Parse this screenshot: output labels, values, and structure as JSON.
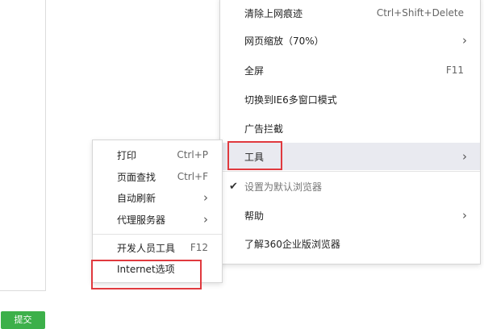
{
  "page": {
    "submit_label": "提交"
  },
  "main_menu": {
    "items": [
      {
        "label": "清除上网痕迹",
        "shortcut": "Ctrl+Shift+Delete"
      },
      {
        "label": "网页缩放（70%）",
        "shortcut": ""
      },
      {
        "label": "全屏",
        "shortcut": "F11"
      },
      {
        "label": "切换到IE6多窗口模式",
        "shortcut": ""
      },
      {
        "label": "广告拦截",
        "shortcut": ""
      },
      {
        "label": "工具",
        "shortcut": ""
      },
      {
        "label": "设置为默认浏览器",
        "shortcut": ""
      },
      {
        "label": "帮助",
        "shortcut": ""
      },
      {
        "label": "了解360企业版浏览器",
        "shortcut": ""
      }
    ]
  },
  "sub_menu": {
    "items": [
      {
        "label": "打印",
        "shortcut": "Ctrl+P"
      },
      {
        "label": "页面查找",
        "shortcut": "Ctrl+F"
      },
      {
        "label": "自动刷新",
        "shortcut": ""
      },
      {
        "label": "代理服务器",
        "shortcut": ""
      },
      {
        "label": "开发人员工具",
        "shortcut": "F12"
      },
      {
        "label": "Internet选项",
        "shortcut": ""
      }
    ]
  },
  "icons": {
    "submenu_arrow": "chevron-right-icon",
    "checkmark": "check-icon"
  },
  "colors": {
    "highlight_border": "#e0393e",
    "hover_bg": "#e9eaf0",
    "submit_bg": "#3cb04a"
  }
}
